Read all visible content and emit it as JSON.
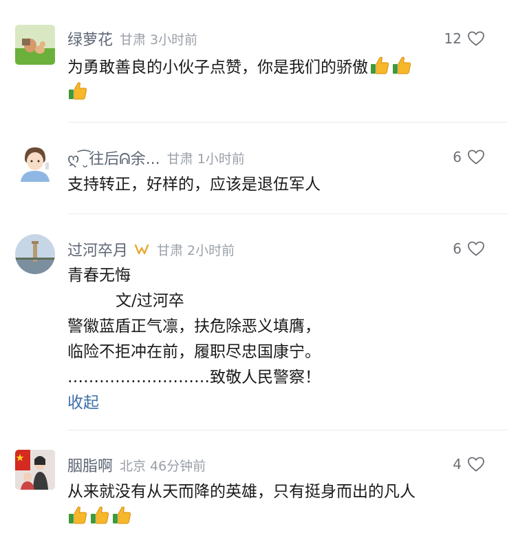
{
  "comments": [
    {
      "user": "绿萝花",
      "location": "甘肃",
      "time": "3小时前",
      "likes": "12",
      "lines": [
        "为勇敢善良的小伙子点赞，你是我们的骄傲"
      ],
      "emoji": "thumbs-up"
    },
    {
      "user": "ღ ͡ ̮往后ᕱ余...",
      "location": "甘肃",
      "time": "1小时前",
      "likes": "6",
      "lines": [
        "支持转正，好样的，应该是退伍军人"
      ]
    },
    {
      "user": "过河卒月",
      "location": "甘肃",
      "time": "2小时前",
      "likes": "6",
      "lines": [
        "青春无悔",
        "文/过河卒",
        "警徽蓝盾正气凛，扶危除恶义填膺，",
        "临险不拒冲在前，履职尽忠国康宁。",
        "………………………致敬人民警察！"
      ],
      "collapse_label": "收起"
    },
    {
      "user": "胭脂啊",
      "location": "北京",
      "time": "46分钟前",
      "likes": "4",
      "lines": [
        "从来就没有从天而降的英雄，只有挺身而出的凡人"
      ],
      "emoji": "thumbs-up"
    }
  ],
  "colors": {
    "name": "#5d6674",
    "meta": "#9aa0a8",
    "text": "#1a1a1a",
    "link": "#3b6ea8",
    "badge": "#e6a833"
  }
}
